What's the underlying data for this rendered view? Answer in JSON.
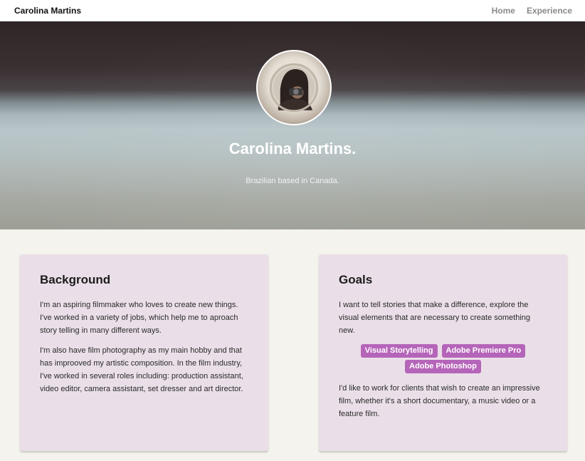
{
  "navbar": {
    "brand": "Carolina Martins",
    "links": [
      "Home",
      "Experience"
    ]
  },
  "hero": {
    "title": "Carolina Martins.",
    "subtitle": "Brazilian based in Canada."
  },
  "background_card": {
    "heading": "Background",
    "paragraphs": [
      "I'm an aspiring filmmaker who loves to create new things. I've worked in a variety of jobs, which help me to aproach story telling in many different ways.",
      "I'm also have film photography as my main hobby and that has improoved my artistic composition. In the film industry, I've worked in several roles including: production assistant, video editor, camera assistant, set dresser and art director."
    ]
  },
  "goals_card": {
    "heading": "Goals",
    "intro": "I want to tell stories that make a difference, explore the visual elements that are necessary to create something new.",
    "skills": [
      "Visual Storytelling",
      "Adobe Premiere Pro",
      "Adobe Photoshop"
    ],
    "outro": "I'd like to work for clients that wish to create an impressive film, whether it's a short documentary, a music video or a feature film."
  },
  "colors": {
    "tag": "#b565b9",
    "card": "#eadfe8",
    "page": "#f4f3ee"
  }
}
